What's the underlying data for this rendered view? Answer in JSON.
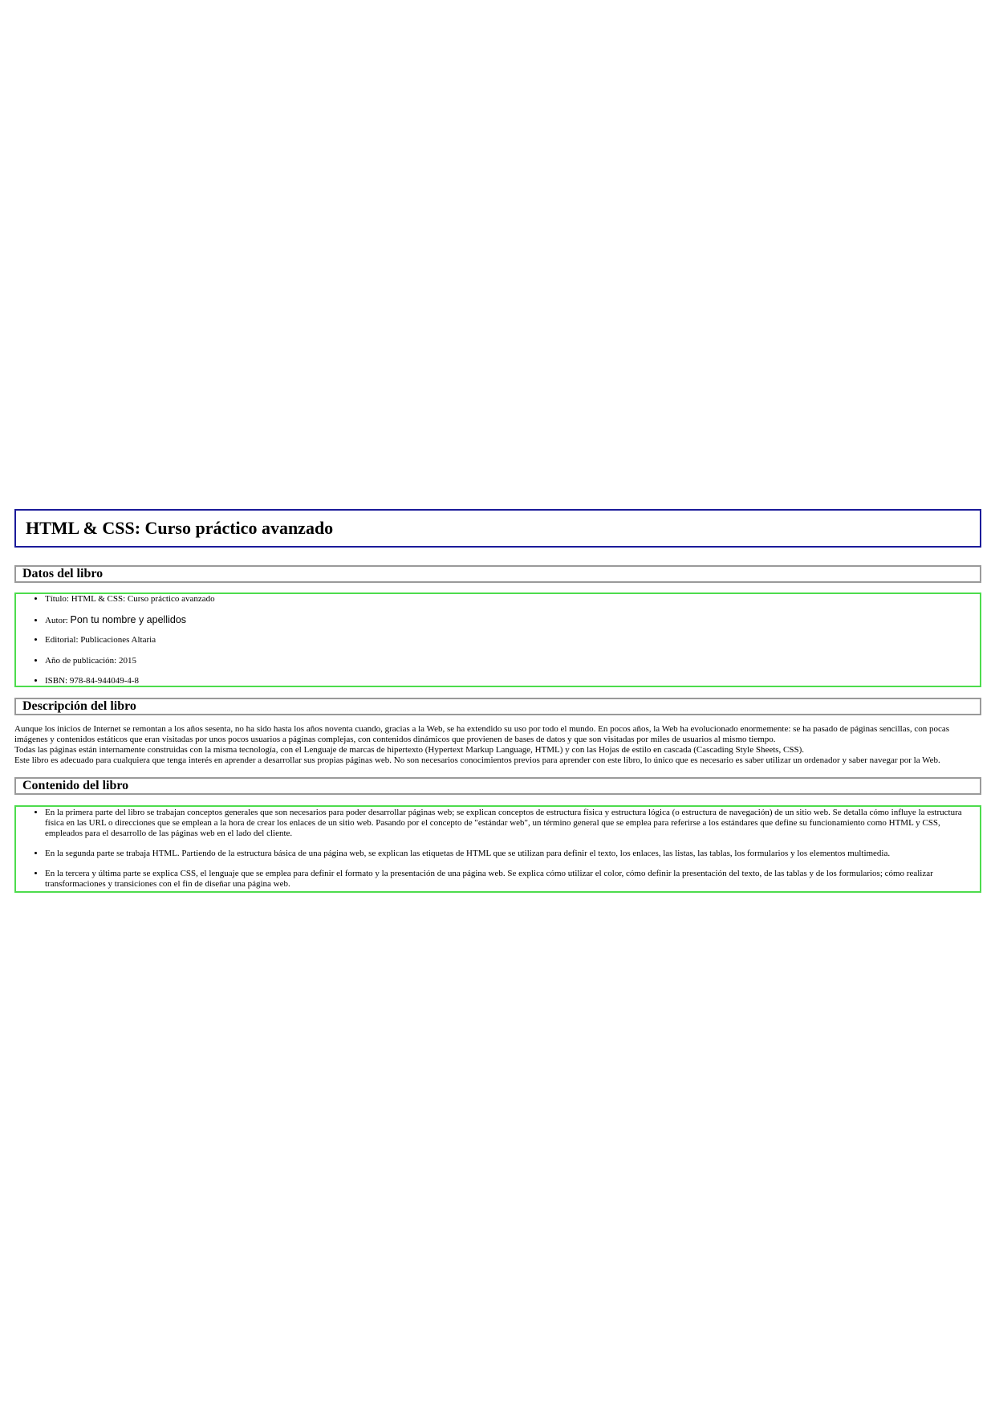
{
  "header": {
    "title": "HTML & CSS: Curso práctico avanzado"
  },
  "datos": {
    "heading": "Datos del libro",
    "items": [
      {
        "label": "Título: ",
        "value": "HTML & CSS: Curso práctico avanzado"
      },
      {
        "label": "Autor: ",
        "value": "Pon tu nombre y apellidos"
      },
      {
        "label": "Editorial: ",
        "value": "Publicaciones Altaria"
      },
      {
        "label": "Año de publicación: ",
        "value": "2015"
      },
      {
        "label": "ISBN: ",
        "value": "978-84-944049-4-8"
      }
    ]
  },
  "descripcion": {
    "heading": "Descripción del libro",
    "paragraphs": [
      "Aunque los inicios de Internet se remontan a los años sesenta, no ha sido hasta los años noventa cuando, gracias a la Web, se ha extendido su uso por todo el mundo. En pocos años, la Web ha evolucionado enormemente: se ha pasado de páginas sencillas, con pocas imágenes y contenidos estáticos que eran visitadas por unos pocos usuarios a páginas complejas, con contenidos dinámicos que provienen de bases de datos y que son visitadas por miles de usuarios al mismo tiempo.",
      "Todas las páginas están internamente construidas con la misma tecnología, con el Lenguaje de marcas de hipertexto (Hypertext Markup Language, HTML) y con las Hojas de estilo en cascada (Cascading Style Sheets, CSS).",
      "Este libro es adecuado para cualquiera que tenga interés en aprender a desarrollar sus propias páginas web. No son necesarios conocimientos previos para aprender con este libro, lo único que es necesario es saber utilizar un ordenador y saber navegar por la Web."
    ]
  },
  "contenido": {
    "heading": "Contenido del libro",
    "items": [
      "En la primera parte del libro se trabajan conceptos generales que son necesarios para poder desarrollar páginas web; se explican conceptos de estructura física y estructura lógica (o estructura de navegación) de un sitio web. Se detalla cómo influye la estructura física en las URL o direcciones que se emplean a la hora de crear los enlaces de un sitio web. Pasando por el concepto de \"estándar web\", un término general que se emplea para referirse a los estándares que define su funcionamiento como HTML y CSS, empleados para el desarrollo de las páginas web en el lado del cliente.",
      "En la segunda parte se trabaja HTML. Partiendo de la estructura básica de una página web, se explican las etiquetas de HTML que se utilizan para definir el texto, los enlaces, las listas, las tablas, los formularios y los elementos multimedia.",
      "En la tercera y última parte se explica CSS, el lenguaje que se emplea para definir el formato y la presentación de una página web. Se explica cómo utilizar el color, cómo definir la presentación del texto, de las tablas y de los formularios; cómo realizar transformaciones y transiciones con el fin de diseñar una página web."
    ]
  },
  "colors": {
    "title_border": "#1b1b9a",
    "section_border": "#9a9a9a",
    "list_border": "#4ddc4d"
  }
}
